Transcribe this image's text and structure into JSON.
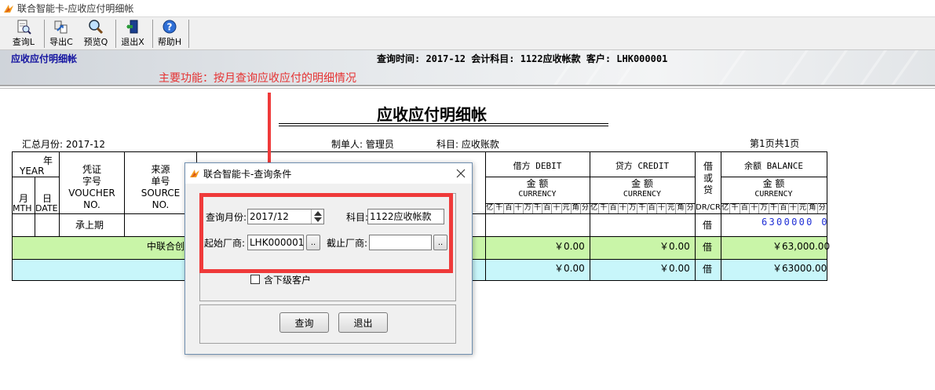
{
  "window": {
    "title": "联合智能卡-应收应付明细帐"
  },
  "toolbar": {
    "items": [
      {
        "label": "查询L",
        "icon": "document-search-icon"
      },
      {
        "label": "导出C",
        "icon": "export-icon"
      },
      {
        "label": "预览Q",
        "icon": "magnifier-icon"
      },
      {
        "label": "退出X",
        "icon": "exit-door-icon"
      },
      {
        "label": "帮助H",
        "icon": "help-icon"
      }
    ]
  },
  "banner": {
    "module": "应收应付明细帐",
    "query_info": "查询时间: 2017-12  会计科目: 1122应收帐款  客户: LHK000001",
    "annotation": "主要功能：按月查询应收应付的明细情况",
    "annotation_color": "#e53333"
  },
  "report": {
    "title": "应收应付明细帐",
    "summary_month": "汇总月份: 2017-12",
    "maker": "制单人: 管理员",
    "subject": "科目: 应收账款",
    "page": "第1页共1页",
    "headers": {
      "year_cn": "年",
      "year_en": "YEAR",
      "month_cn": "月",
      "month_en": "MTH",
      "day_cn": "日",
      "day_en": "DATE",
      "voucher": [
        "凭证",
        "字号",
        "VOUCHER",
        "NO."
      ],
      "source": [
        "来源",
        "单号",
        "SOURCE",
        "NO."
      ],
      "debit": "借方 DEBIT",
      "credit": "贷方 CREDIT",
      "balance": "余额 BALANCE",
      "amount_cn": "金  额",
      "amount_en": "CURRENCY",
      "dc": [
        "借",
        "或",
        "贷"
      ],
      "dc_en": "DR/CR",
      "digit_units": [
        "亿",
        "千",
        "百",
        "十",
        "万",
        "千",
        "百",
        "十",
        "元",
        "角",
        "分"
      ]
    },
    "rows": [
      {
        "summary": "承上期",
        "dc": "借",
        "balance": "6300000 0"
      },
      {
        "summary": "中联合创",
        "debit": "￥0.00",
        "credit": "￥0.00",
        "dc": "借",
        "balance": "￥63,000.00"
      },
      {
        "debit": "￥0.00",
        "credit": "￥0.00",
        "dc": "借",
        "balance": "￥63000.00"
      }
    ],
    "row_colors": {
      "green": "#c9f5a8",
      "cyan": "#c8f6fa"
    },
    "balance_digit_color": "#1f2fd6"
  },
  "dialog": {
    "title": "联合智能卡-查询条件",
    "month_label": "查询月份:",
    "month_value": "2017/12",
    "subject_label": "科目:",
    "subject_value": "1122应收帐款",
    "start_vendor_label": "起始厂商:",
    "start_vendor_value": "LHK000001",
    "end_vendor_label": "截止厂商:",
    "end_vendor_value": "",
    "browse_label": "..",
    "include_sub_label": "含下级客户",
    "include_sub_checked": false,
    "query_button": "查询",
    "exit_button": "退出"
  }
}
